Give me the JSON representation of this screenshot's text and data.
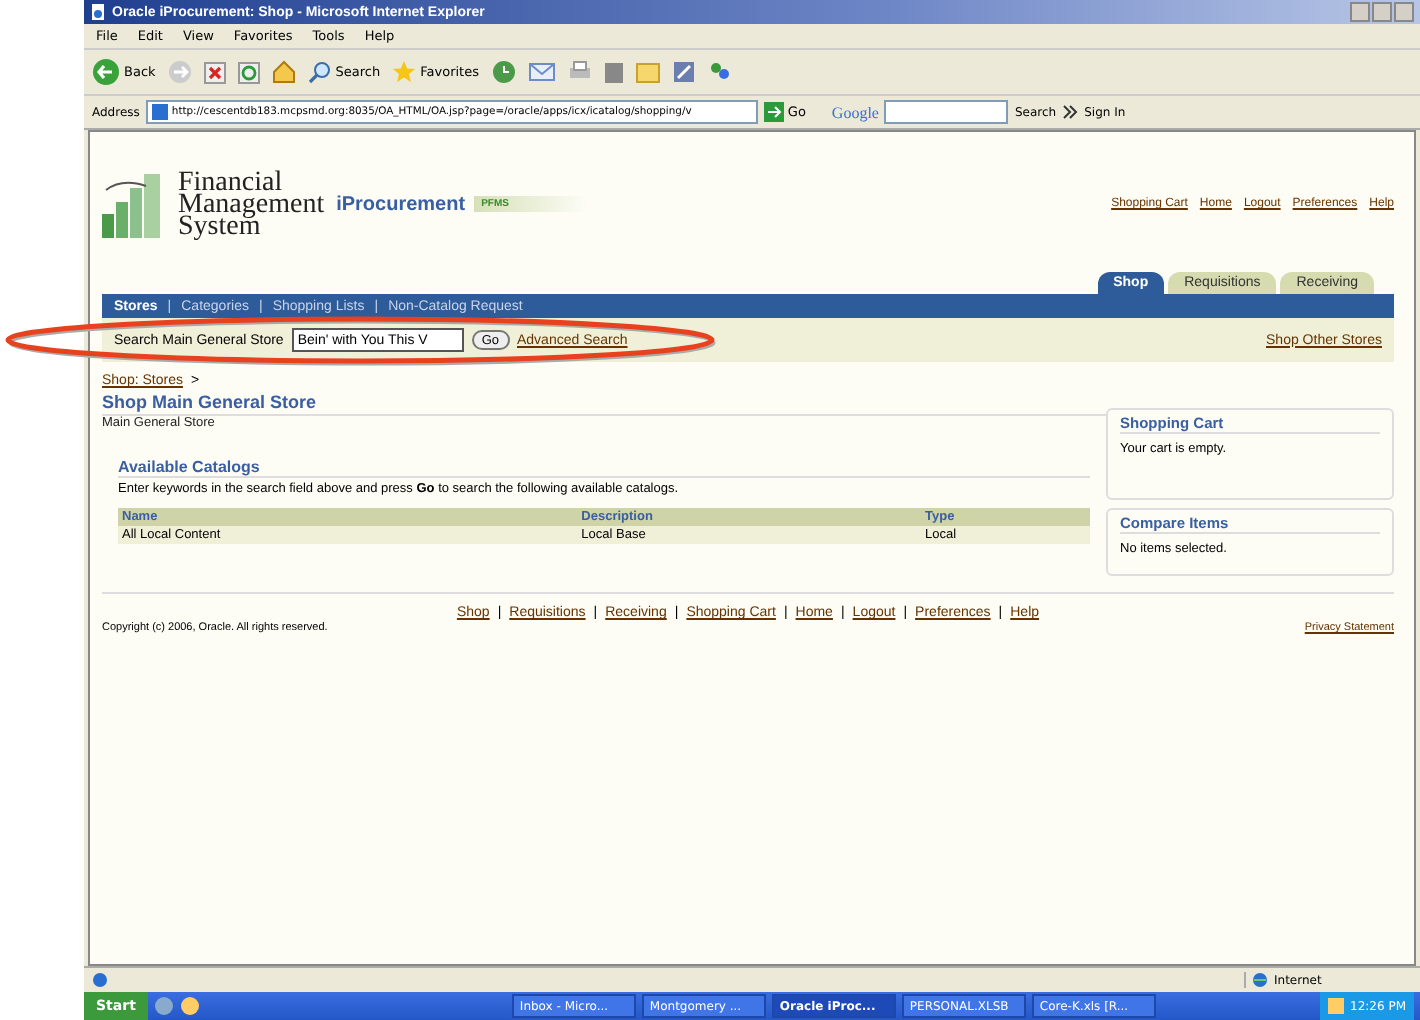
{
  "window": {
    "title": "Oracle iProcurement: Shop - Microsoft Internet Explorer"
  },
  "menu": [
    "File",
    "Edit",
    "View",
    "Favorites",
    "Tools",
    "Help"
  ],
  "toolbar": {
    "back": "Back",
    "search": "Search",
    "favorites": "Favorites"
  },
  "address": {
    "label": "Address",
    "url": "http://cescentdb183.mcpsmd.org:8035/OA_HTML/OA.jsp?page=/oracle/apps/icx/icatalog/shopping/v",
    "go": "Go",
    "google": "Google",
    "google_search": "Search",
    "sign_in": "Sign In"
  },
  "header": {
    "logo_lines": [
      "Financial",
      "Management",
      "System"
    ],
    "app": "iProcurement",
    "badge": "PFMS",
    "global_links": [
      "Shopping Cart",
      "Home",
      "Logout",
      "Preferences",
      "Help"
    ]
  },
  "tabs": [
    {
      "label": "Shop",
      "selected": true
    },
    {
      "label": "Requisitions",
      "selected": false
    },
    {
      "label": "Receiving",
      "selected": false
    }
  ],
  "subtab_separator": "|",
  "subtabs": [
    {
      "label": "Stores",
      "selected": true
    },
    {
      "label": "Categories",
      "selected": false
    },
    {
      "label": "Shopping Lists",
      "selected": false
    },
    {
      "label": "Non-Catalog Request",
      "selected": false
    }
  ],
  "search": {
    "label": "Search Main General Store",
    "value": "Bein' with You This V",
    "go": "Go",
    "advanced": "Advanced Search",
    "other": "Shop Other Stores"
  },
  "breadcrumb": {
    "link": "Shop: Stores",
    "separator": ">"
  },
  "heading": "Shop Main General Store",
  "subheading": "Main General Store",
  "catalogs": {
    "title": "Available Catalogs",
    "instructions": "Enter keywords in the search field above and press **Go** to search the following available catalogs.",
    "columns": [
      "Name",
      "Description",
      "Type"
    ],
    "rows": [
      [
        "All Local Content",
        "Local Base",
        "Local"
      ]
    ]
  },
  "side_boxes": [
    {
      "title": "Shopping Cart",
      "text": "Your cart is empty."
    },
    {
      "title": "Compare Items",
      "text": "No items selected."
    }
  ],
  "footer": {
    "separator": "|",
    "links": [
      "Shop",
      "Requisitions",
      "Receiving",
      "Shopping Cart",
      "Home",
      "Logout",
      "Preferences",
      "Help"
    ],
    "copyright": "Copyright (c) 2006, Oracle. All rights reserved.",
    "privacy": "Privacy Statement"
  },
  "status_bar": {
    "zone": "Internet"
  },
  "taskbar": {
    "start": "Start",
    "tasks": [
      {
        "label": "Inbox - Micro...",
        "selected": false
      },
      {
        "label": "Montgomery ...",
        "selected": false
      },
      {
        "label": "Oracle iProc...",
        "selected": true
      },
      {
        "label": "PERSONAL.XLSB",
        "selected": false
      },
      {
        "label": "Core-K.xls [R...",
        "selected": false
      }
    ],
    "clock": "12:26 PM"
  }
}
